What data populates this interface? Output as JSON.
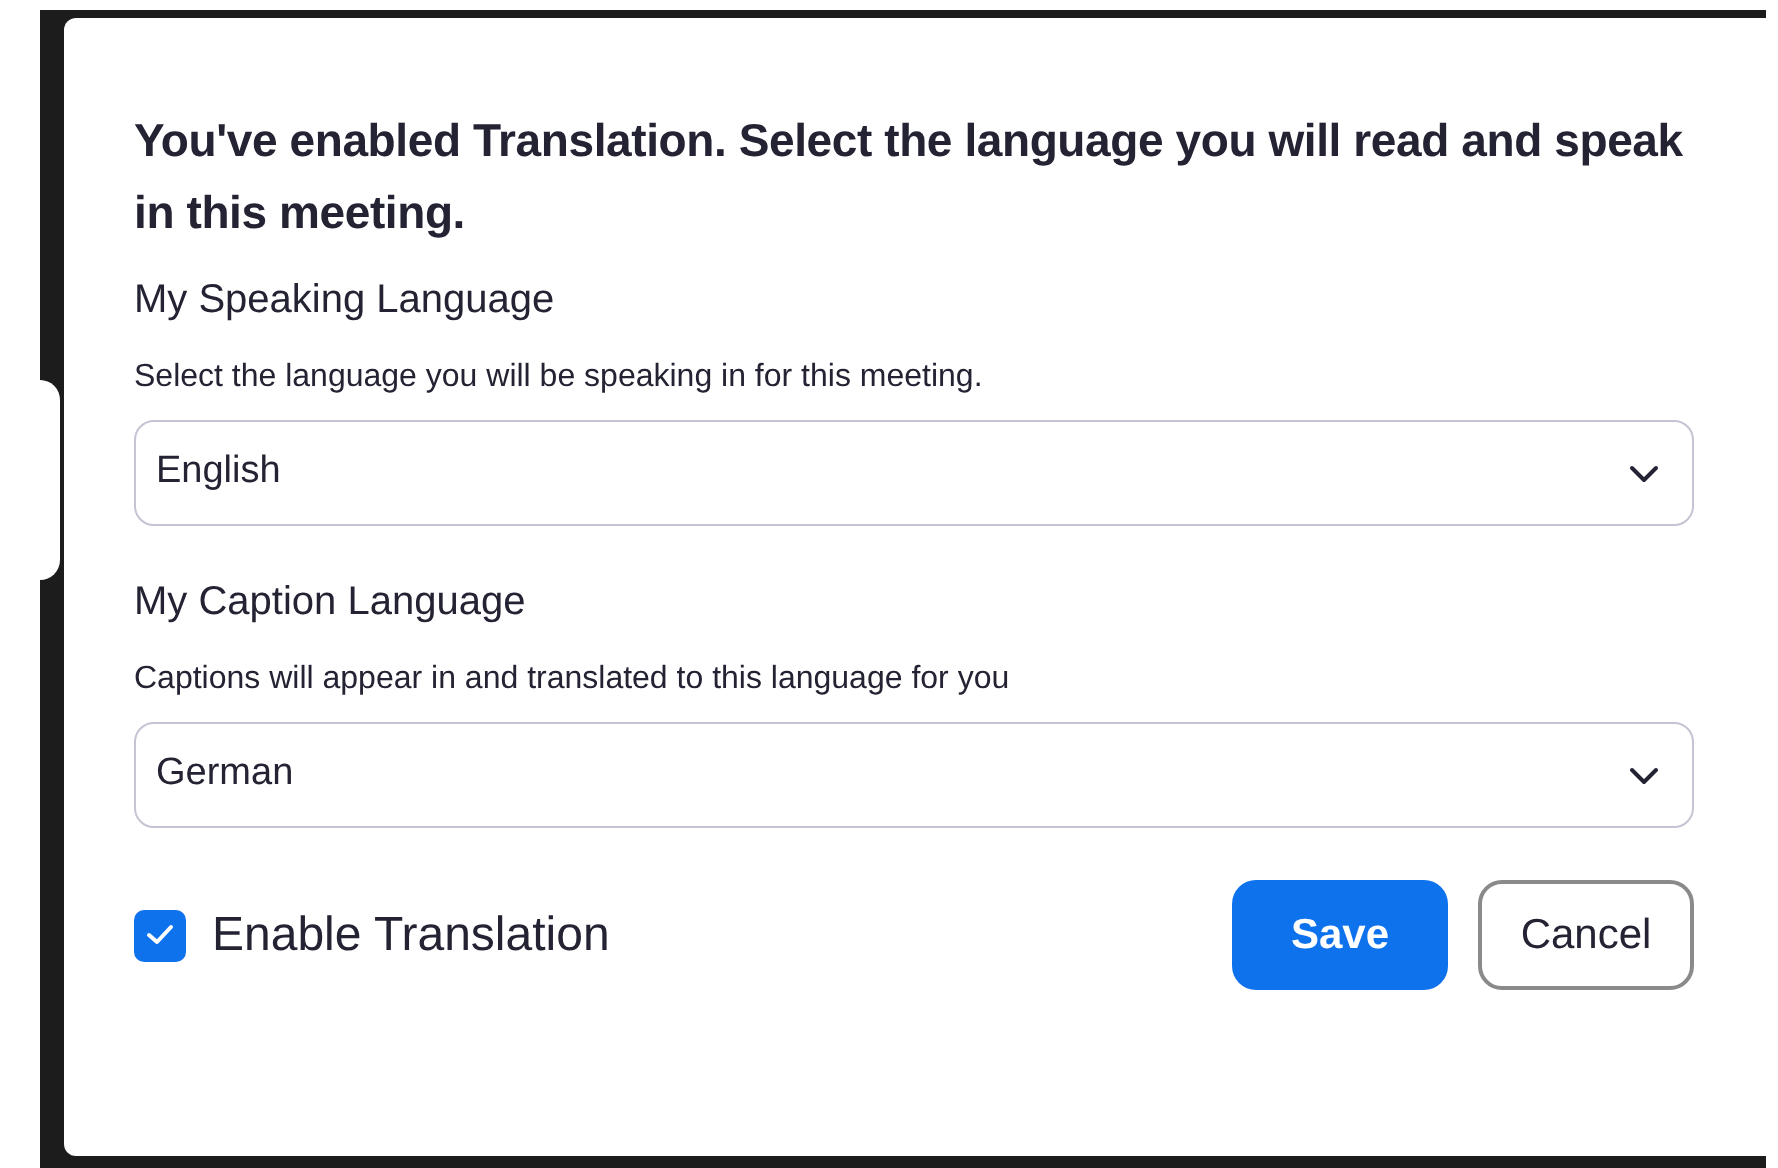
{
  "dialog": {
    "title": "You've enabled Translation. Select the language you will read and speak in this meeting.",
    "sections": [
      {
        "label": "My Speaking Language",
        "description": "Select the language you will be speaking in for this meeting.",
        "value": "English"
      },
      {
        "label": "My Caption Language",
        "description": "Captions will appear in and translated to this language for you",
        "value": "German"
      }
    ],
    "enable_translation": {
      "label": "Enable Translation",
      "checked": true
    },
    "buttons": [
      {
        "label": "Save",
        "kind": "primary"
      },
      {
        "label": "Cancel",
        "kind": "secondary"
      }
    ]
  }
}
